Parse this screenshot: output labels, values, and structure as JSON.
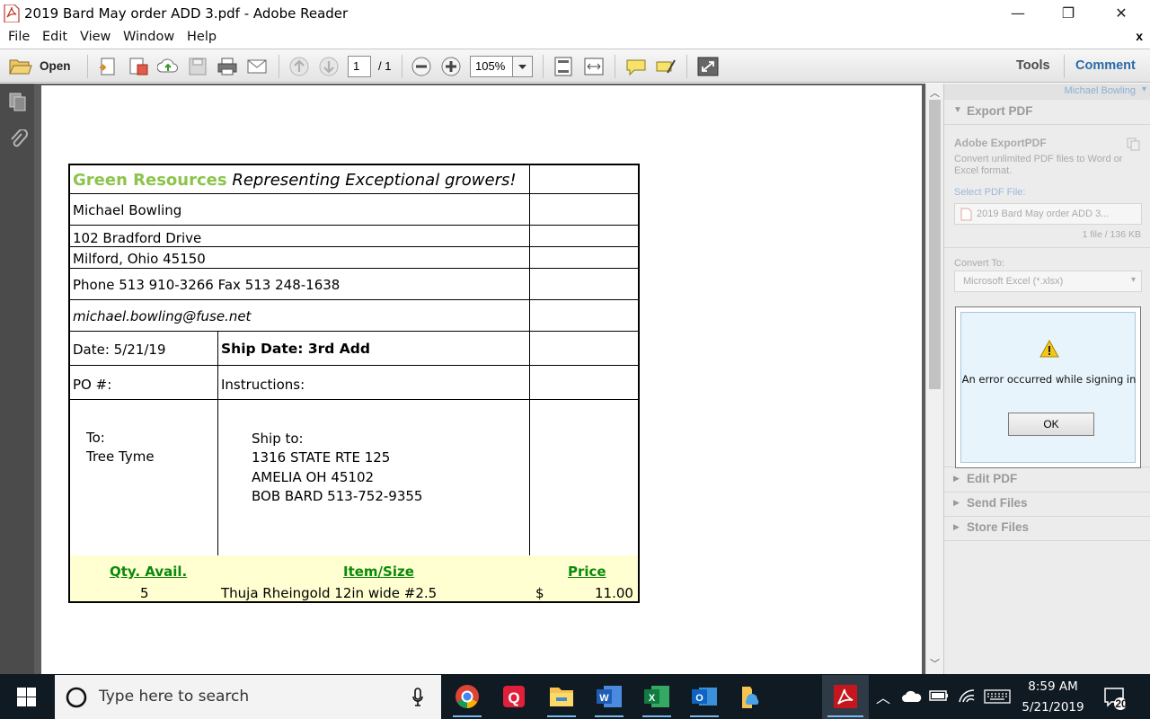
{
  "window": {
    "title": "2019 Bard May order ADD 3.pdf - Adobe Reader",
    "minimize": "—",
    "maximize": "❐",
    "close": "✕"
  },
  "menu": {
    "items": [
      "File",
      "Edit",
      "View",
      "Window",
      "Help"
    ],
    "close_doc": "x"
  },
  "toolbar": {
    "open_label": "Open",
    "page_current": "1",
    "page_total": "/ 1",
    "zoom": "105%",
    "tools_label": "Tools",
    "comment_label": "Comment"
  },
  "document": {
    "company": "Green Resources",
    "tagline": "Representing Exceptional growers!",
    "contact_name": "Michael Bowling",
    "address1": "102 Bradford Drive",
    "address2": "Milford, Ohio 45150",
    "phone_fax": "Phone 513 910-3266  Fax 513 248-1638",
    "email": "michael.bowling@fuse.net",
    "date": "Date: 5/21/19",
    "ship_date": "Ship Date: 3rd Add",
    "po": "PO #:",
    "instructions": "Instructions:",
    "to_label": "To:",
    "to_name": "Tree Tyme",
    "ship_to_label": "Ship to:",
    "ship_to_lines": [
      "1316 STATE RTE 125",
      "AMELIA OH 45102",
      "BOB BARD 513-752-9355"
    ],
    "col_qty": "Qty. Avail.",
    "col_item": "Item/Size",
    "col_price": "Price",
    "row": {
      "qty": "5",
      "item": "Thuja Rheingold 12in wide #2.5",
      "currency": "$",
      "price": "11.00"
    },
    "company_color": "#8cc44c",
    "header_row_bg": "#ffffd2",
    "header_text_color": "#0a8a0a"
  },
  "right_panel": {
    "user": "Michael Bowling",
    "export_pdf": "Export PDF",
    "adobe_exportpdf": "Adobe ExportPDF",
    "convert_desc": "Convert unlimited PDF files to Word or Excel format.",
    "select_pdf": "Select PDF File:",
    "selected_file": "2019 Bard May order ADD 3...",
    "file_info": "1 file / 136 KB",
    "convert_to": "Convert To:",
    "convert_format": "Microsoft Excel (*.xlsx)",
    "edit_pdf": "Edit PDF",
    "send_files": "Send Files",
    "store_files": "Store Files"
  },
  "dialog": {
    "message": "An error occurred while signing in",
    "ok": "OK"
  },
  "taskbar": {
    "search_placeholder": "Type here to search",
    "time": "8:59 AM",
    "date": "5/21/2019",
    "notification_count": "20"
  }
}
